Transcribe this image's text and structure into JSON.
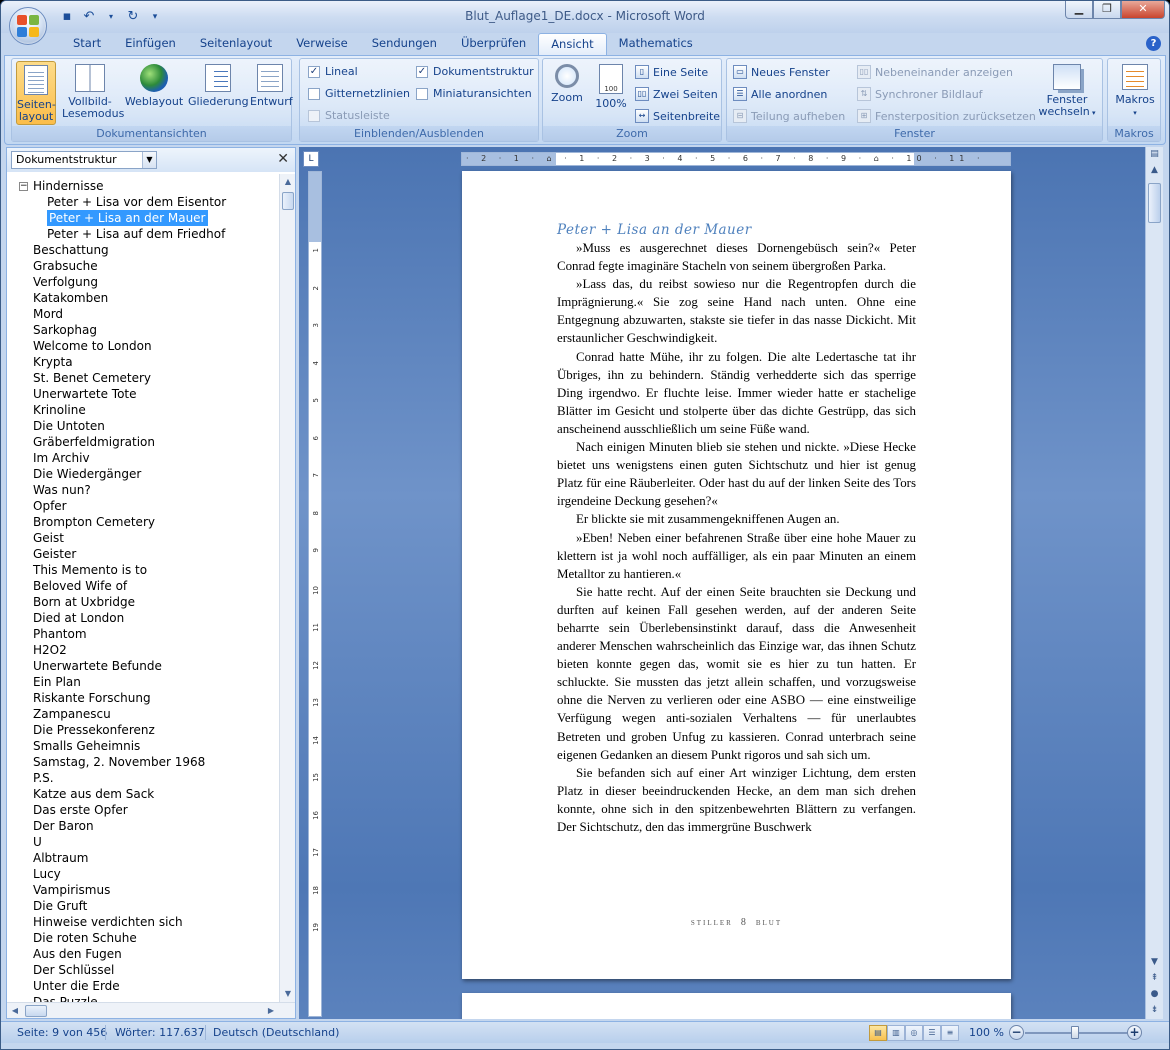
{
  "window": {
    "title": "Blut_Auflage1_DE.docx - Microsoft Word"
  },
  "tabs": [
    "Start",
    "Einfügen",
    "Seitenlayout",
    "Verweise",
    "Sendungen",
    "Überprüfen",
    "Ansicht",
    "Mathematics"
  ],
  "active_tab": "Ansicht",
  "ribbon": {
    "views": {
      "label": "Dokumentansichten",
      "print_layout": "Seiten-\nlayout",
      "fullscreen": "Vollbild-\nLesemodus",
      "web": "Weblayout",
      "outline": "Gliederung",
      "draft": "Entwurf"
    },
    "show": {
      "label": "Einblenden/Ausblenden",
      "ruler": "Lineal",
      "gridlines": "Gitternetzlinien",
      "statusbar": "Statusleiste",
      "docmap": "Dokumentstruktur",
      "thumbnails": "Miniaturansichten"
    },
    "zoom": {
      "label": "Zoom",
      "zoom": "Zoom",
      "percent": "100%",
      "one_page": "Eine Seite",
      "two_pages": "Zwei Seiten",
      "page_width": "Seitenbreite"
    },
    "window": {
      "label": "Fenster",
      "new_window": "Neues Fenster",
      "arrange_all": "Alle anordnen",
      "split": "Teilung aufheben",
      "side_by_side": "Nebeneinander anzeigen",
      "sync_scroll": "Synchroner Bildlauf",
      "reset_pos": "Fensterposition zurücksetzen",
      "switch": "Fenster\nwechseln"
    },
    "macros": {
      "label": "Makros",
      "button": "Makros"
    }
  },
  "nav": {
    "selector": "Dokumentstruktur",
    "items": [
      {
        "label": "Hindernisse",
        "level": 0,
        "expanded": true
      },
      {
        "label": "Peter + Lisa vor dem Eisentor",
        "level": 1
      },
      {
        "label": "Peter + Lisa an der Mauer",
        "level": 1,
        "selected": true
      },
      {
        "label": "Peter + Lisa auf dem Friedhof",
        "level": 1
      },
      {
        "label": "Beschattung",
        "level": 0
      },
      {
        "label": "Grabsuche",
        "level": 0
      },
      {
        "label": "Verfolgung",
        "level": 0
      },
      {
        "label": "Katakomben",
        "level": 0
      },
      {
        "label": "Mord",
        "level": 0
      },
      {
        "label": "Sarkophag",
        "level": 0
      },
      {
        "label": "Welcome to London",
        "level": 0
      },
      {
        "label": "Krypta",
        "level": 0
      },
      {
        "label": "St. Benet Cemetery",
        "level": 0
      },
      {
        "label": "Unerwartete Tote",
        "level": 0
      },
      {
        "label": "Krinoline",
        "level": 0
      },
      {
        "label": "Die Untoten",
        "level": 0
      },
      {
        "label": "Gräberfeldmigration",
        "level": 0
      },
      {
        "label": "Im Archiv",
        "level": 0
      },
      {
        "label": "Die Wiedergänger",
        "level": 0
      },
      {
        "label": "Was nun?",
        "level": 0
      },
      {
        "label": "Opfer",
        "level": 0
      },
      {
        "label": "Brompton Cemetery",
        "level": 0
      },
      {
        "label": "Geist",
        "level": 0
      },
      {
        "label": "Geister",
        "level": 0
      },
      {
        "label": "This Memento is to",
        "level": 0
      },
      {
        "label": "Beloved Wife of",
        "level": 0
      },
      {
        "label": "Born at Uxbridge",
        "level": 0
      },
      {
        "label": "Died at London",
        "level": 0
      },
      {
        "label": "Phantom",
        "level": 0
      },
      {
        "label": "H2O2",
        "level": 0
      },
      {
        "label": "Unerwartete Befunde",
        "level": 0
      },
      {
        "label": "Ein Plan",
        "level": 0
      },
      {
        "label": "Riskante Forschung",
        "level": 0
      },
      {
        "label": "Zampanescu",
        "level": 0
      },
      {
        "label": "Die Pressekonferenz",
        "level": 0
      },
      {
        "label": "Smalls Geheimnis",
        "level": 0
      },
      {
        "label": "Samstag, 2. November 1968",
        "level": 0
      },
      {
        "label": "P.S.",
        "level": 0
      },
      {
        "label": "Katze aus dem Sack",
        "level": 0
      },
      {
        "label": "Das erste Opfer",
        "level": 0
      },
      {
        "label": "Der Baron",
        "level": 0
      },
      {
        "label": "U",
        "level": 0
      },
      {
        "label": "Albtraum",
        "level": 0
      },
      {
        "label": "Lucy",
        "level": 0
      },
      {
        "label": "Vampirismus",
        "level": 0
      },
      {
        "label": "Die Gruft",
        "level": 0
      },
      {
        "label": "Hinweise verdichten sich",
        "level": 0
      },
      {
        "label": "Die roten Schuhe",
        "level": 0
      },
      {
        "label": "Aus den Fugen",
        "level": 0
      },
      {
        "label": "Der Schlüssel",
        "level": 0
      },
      {
        "label": "Unter die Erde",
        "level": 0
      },
      {
        "label": "Das Puzzle",
        "level": 0
      }
    ]
  },
  "document": {
    "heading": "Peter + Lisa an der Mauer",
    "paragraphs": [
      "»Muss es ausgerechnet dieses Dornengebüsch sein?« Peter Conrad fegte imaginäre Stacheln von seinem übergroßen Parka.",
      "»Lass das, du reibst sowieso nur die Regentropfen durch die Imprägnierung.« Sie zog seine Hand nach unten. Ohne eine Entgegnung abzuwarten, stakste sie tiefer in das nasse Dickicht. Mit erstaunlicher Geschwindigkeit.",
      "Conrad hatte Mühe, ihr zu folgen. Die alte Ledertasche tat ihr Übriges, ihn zu behindern. Ständig verhedderte sich das sperrige Ding irgendwo. Er fluchte leise. Immer wieder hatte er stachelige Blätter im Gesicht und stolperte über das dichte Gestrüpp, das sich anscheinend ausschließlich um seine Füße wand.",
      "Nach einigen Minuten blieb sie stehen und nickte. »Diese Hecke bietet uns wenigstens einen guten Sichtschutz und hier ist genug Platz für eine Räuberleiter. Oder hast du auf der linken Seite des Tors irgendeine Deckung gesehen?«",
      "Er blickte sie mit zusammengekniffenen Augen an.",
      "»Eben! Neben einer befahrenen Straße über eine hohe Mauer zu klettern ist ja wohl noch auffälliger, als ein paar Minuten an einem Metalltor zu hantieren.«",
      "Sie hatte recht. Auf der einen Seite brauchten sie Deckung und durften auf keinen Fall gesehen werden, auf der anderen Seite beharrte sein Überlebensinstinkt darauf, dass die Anwesenheit anderer Menschen wahrscheinlich das Einzige war, das ihnen Schutz bieten konnte gegen das, womit sie es hier zu tun hatten. Er schluckte. Sie mussten das jetzt allein schaffen, und vorzugsweise ohne die Nerven zu verlieren oder eine ASBO — eine einstweilige Verfügung wegen anti-sozialen Verhaltens — für unerlaubtes Betreten und groben Unfug zu kassieren. Conrad unterbrach seine eigenen Gedanken an diesem Punkt rigoros und sah sich um.",
      "Sie befanden sich auf einer Art winziger Lichtung, dem ersten Platz in dieser beeindruckenden Hecke, an dem man sich drehen konnte, ohne sich in den spitzenbewehrten Blättern zu verfangen. Der Sichtschutz, den das immergrüne Buschwerk"
    ],
    "footer_left": "STILLER",
    "footer_page": "8",
    "footer_right": "BLUT"
  },
  "ruler": {
    "h": "· 2 · 1 · ⌂ · 1 · 2 · 3 · 4 · 5 · 6 · 7 · 8 · 9 · ⌂ · 10 · 11 ·"
  },
  "status": {
    "page": "Seite: 9 von 456",
    "words": "Wörter: 117.637",
    "language": "Deutsch (Deutschland)",
    "zoom": "100 %"
  }
}
